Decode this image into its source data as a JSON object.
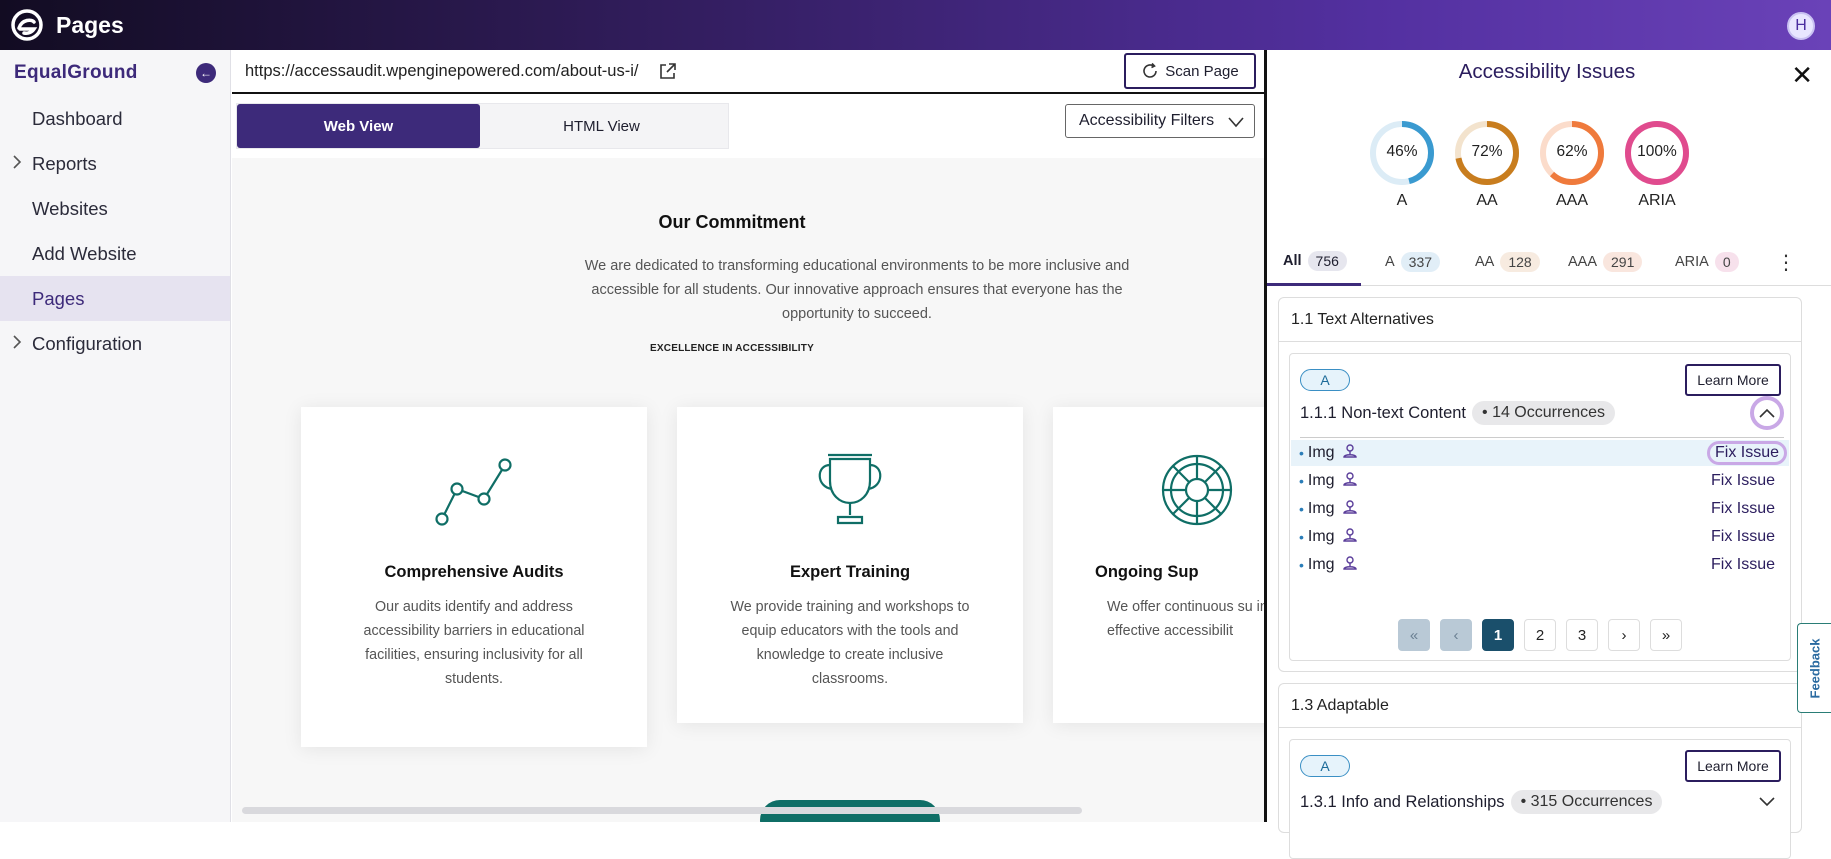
{
  "app": {
    "title": "Pages",
    "avatar_initial": "H"
  },
  "sidebar": {
    "brand": "EqualGround",
    "items": [
      {
        "label": "Dashboard",
        "expandable": false,
        "active": false
      },
      {
        "label": "Reports",
        "expandable": true,
        "active": false
      },
      {
        "label": "Websites",
        "expandable": false,
        "active": false
      },
      {
        "label": "Add Website",
        "expandable": false,
        "active": false
      },
      {
        "label": "Pages",
        "expandable": false,
        "active": true
      },
      {
        "label": "Configuration",
        "expandable": true,
        "active": false
      }
    ]
  },
  "toolbar": {
    "url": "https://accessaudit.wpenginepowered.com/about-us-i/",
    "scan_label": "Scan Page",
    "view_tabs": [
      "Web View",
      "HTML View"
    ],
    "active_view": "Web View",
    "filters_label": "Accessibility Filters"
  },
  "preview": {
    "title": "Our Commitment",
    "description": "We are dedicated to transforming educational environments to be more inclusive and accessible for all students. Our innovative approach ensures that everyone has the opportunity to succeed.",
    "subtitle": "EXCELLENCE IN ACCESSIBILITY",
    "cards": [
      {
        "icon": "line-chart-icon",
        "heading": "Comprehensive Audits",
        "body": "Our audits identify and address accessibility barriers in educational facilities, ensuring inclusivity for all students."
      },
      {
        "icon": "trophy-icon",
        "heading": "Expert Training",
        "body": "We provide training and workshops to equip educators with the tools and knowledge to create inclusive classrooms."
      },
      {
        "icon": "lifebuoy-icon",
        "heading": "Ongoing Sup",
        "body": "We offer continuous su institutions implement effective accessibilit"
      }
    ]
  },
  "panel": {
    "title": "Accessibility Issues",
    "scores": [
      {
        "label": "A",
        "pct_text": "46%",
        "value": 46,
        "color": "#3a9ad0",
        "track": "#dcecf6"
      },
      {
        "label": "AA",
        "pct_text": "72%",
        "value": 72,
        "color": "#c87d1e",
        "track": "#f3e3cd"
      },
      {
        "label": "AAA",
        "pct_text": "62%",
        "value": 62,
        "color": "#ef7a3c",
        "track": "#fbdccb"
      },
      {
        "label": "ARIA",
        "pct_text": "100%",
        "value": 100,
        "color": "#e04b8e",
        "track": "#f8d6e6"
      }
    ],
    "tabs": [
      {
        "label": "All",
        "count": "756",
        "badge_bg": "#e6e6ee",
        "active": true
      },
      {
        "label": "A",
        "count": "337",
        "badge_bg": "#e1eef7",
        "active": false
      },
      {
        "label": "AA",
        "count": "128",
        "badge_bg": "#f7ebe0",
        "active": false
      },
      {
        "label": "AAA",
        "count": "291",
        "badge_bg": "#f9e6de",
        "active": false
      },
      {
        "label": "ARIA",
        "count": "0",
        "badge_bg": "#f7e1ec",
        "active": false
      }
    ],
    "sections": [
      {
        "title": "1.1 Text Alternatives",
        "level": "A",
        "learn_more": "Learn More",
        "criterion": "1.1.1 Non-text Content",
        "occurrences": "• 14 Occurrences",
        "expanded": true,
        "rows": [
          {
            "label": "Img",
            "fix": "Fix Issue"
          },
          {
            "label": "Img",
            "fix": "Fix Issue"
          },
          {
            "label": "Img",
            "fix": "Fix Issue"
          },
          {
            "label": "Img",
            "fix": "Fix Issue"
          },
          {
            "label": "Img",
            "fix": "Fix Issue"
          }
        ],
        "pagination": {
          "first": "«",
          "prev": "‹",
          "pages": [
            "1",
            "2",
            "3"
          ],
          "current": "1",
          "next": "›",
          "last": "»"
        }
      },
      {
        "title": "1.3 Adaptable",
        "level": "A",
        "learn_more": "Learn More",
        "criterion": "1.3.1 Info and Relationships",
        "occurrences": "• 315 Occurrences",
        "expanded": false
      }
    ]
  },
  "feedback_label": "Feedback",
  "colors": {
    "brand": "#3d2a7a",
    "accent_teal": "#0f6e66",
    "highlight": "#c9a8e6"
  }
}
